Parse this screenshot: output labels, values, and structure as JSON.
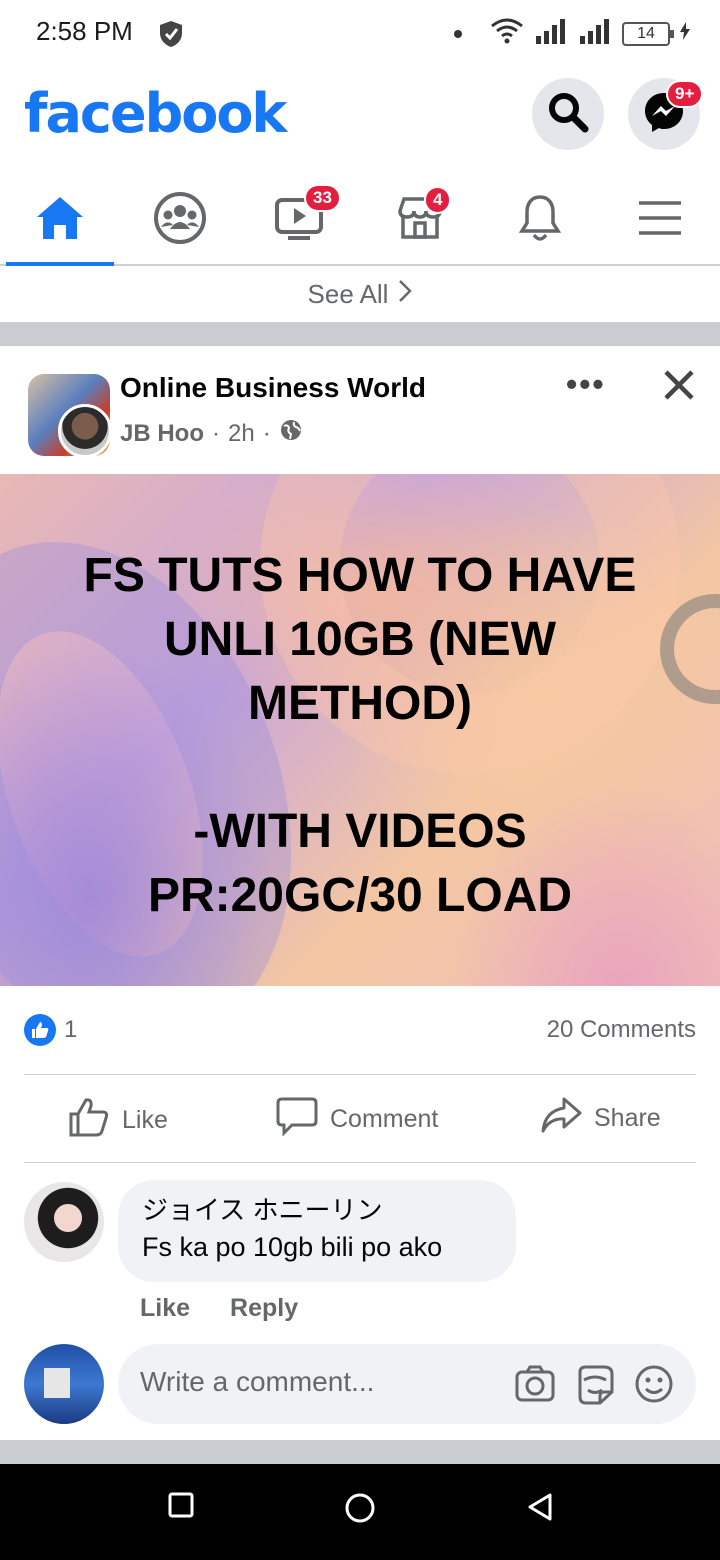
{
  "status_bar": {
    "time": "2:58 PM",
    "battery": "14"
  },
  "header": {
    "logo": "facebook",
    "messenger_badge": "9+"
  },
  "nav": {
    "tabs": [
      {
        "name": "home",
        "active": true
      },
      {
        "name": "groups"
      },
      {
        "name": "watch",
        "badge": "33"
      },
      {
        "name": "marketplace",
        "badge": "4"
      },
      {
        "name": "notifications"
      },
      {
        "name": "menu"
      }
    ]
  },
  "see_all": "See All",
  "post": {
    "group_name": "Online Business World",
    "author": "JB Hoo",
    "time": "2h",
    "separator": "·",
    "image_text": "FS TUTS HOW TO HAVE\nUNLI 10GB (NEW\nMETHOD)\n\n-WITH VIDEOS\nPR:20GC/30 LOAD",
    "like_count": "1",
    "comment_count": "20 Comments",
    "actions": {
      "like": "Like",
      "comment": "Comment",
      "share": "Share"
    }
  },
  "comment": {
    "author": "ジョイス ホニーリン",
    "text": "Fs ka po 10gb bili po ako",
    "like": "Like",
    "reply": "Reply"
  },
  "write_comment": {
    "placeholder": "Write a comment..."
  },
  "colors": {
    "brand": "#1877f2",
    "badge": "#e41e3f",
    "secondary_text": "#65676b"
  }
}
